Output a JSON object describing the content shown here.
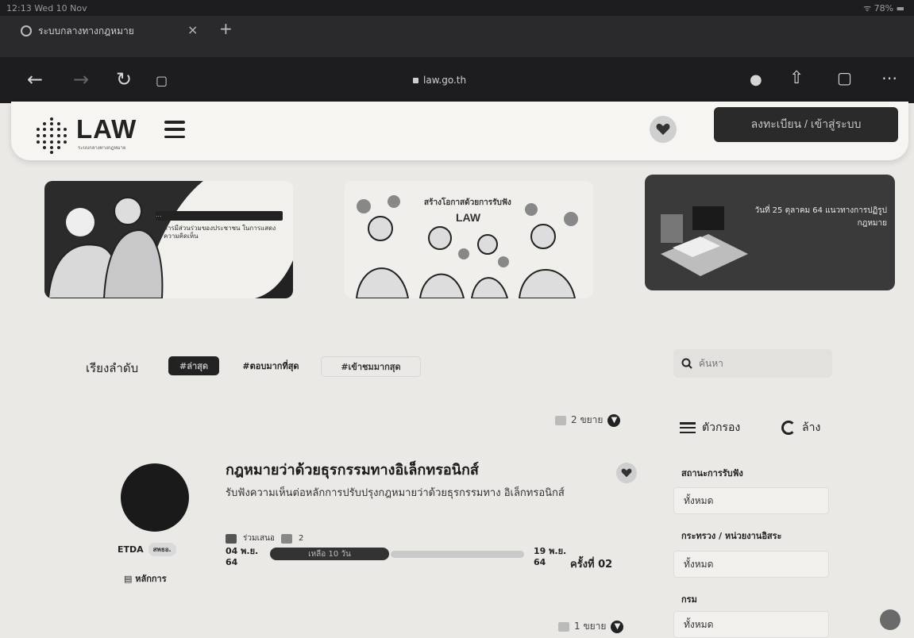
{
  "status_bar": {
    "time": "12:13 Wed 10 Nov",
    "system": "ᯤ 78% ▬"
  },
  "browser": {
    "tab_title": "ระบบกลางทางกฎหมาย",
    "tab_close": "×",
    "tab_new": "+",
    "url": "law.go.th",
    "nav_icons": [
      "back-icon",
      "forward-icon",
      "reload-icon",
      "translate-icon",
      "mic-icon",
      "share-icon",
      "tabs-icon",
      "more-icon"
    ]
  },
  "header": {
    "logo": "LAW",
    "logo_sub": "ระบบกลางทางกฎหมาย",
    "login_label": "ลงทะเบียน / เข้าสู่ระบบ"
  },
  "banners": {
    "b1_title": "...",
    "b1_text": "การมีส่วนร่วมของประชาชน ในการแสดงความคิดเห็น",
    "b2_text": "สร้างโอกาสด้วยการรับฟัง",
    "b2_logo": "LAW",
    "b3_text": "วันที่ 25 ตุลาคม 64 แนวทางการปฏิรูปกฎหมาย"
  },
  "sort": {
    "label": "เรียงลำดับ",
    "options": [
      "#ล่าสุด",
      "#ตอบมากที่สุด",
      "#เข้าชมมากสุด"
    ]
  },
  "search": {
    "placeholder": "ค้นหา"
  },
  "list": {
    "count_top": "2 ขยาย",
    "count_bottom": "1 ขยาย",
    "item": {
      "agency": "ETDA",
      "agency_tag": "สพธอ.",
      "principle": "หลักการ",
      "title": "กฎหมายว่าด้วยธุรกรรมทางอิเล็กทรอนิกส์",
      "description": "รับฟังความเห็นต่อหลักการปรับปรุงกฎหมายว่าด้วยธุรกรรมทาง อิเล็กทรอนิกส์",
      "participants_label": "ร่วมเสนอ",
      "participants_count": "2",
      "start_date": "04 พ.ย. 64",
      "remaining": "เหลือ 10 วัน",
      "end_date": "19 พ.ย. 64",
      "round_label": "ครั้งที่",
      "round_value": "02"
    }
  },
  "filters": {
    "title": "ตัวกรอง",
    "clear": "ล้าง",
    "groups": [
      {
        "label": "สถานะการรับฟัง",
        "value": "ทั้งหมด"
      },
      {
        "label": "กระทรวง / หน่วยงานอิสระ",
        "value": "ทั้งหมด"
      },
      {
        "label": "กรม",
        "value": "ทั้งหมด"
      }
    ]
  }
}
